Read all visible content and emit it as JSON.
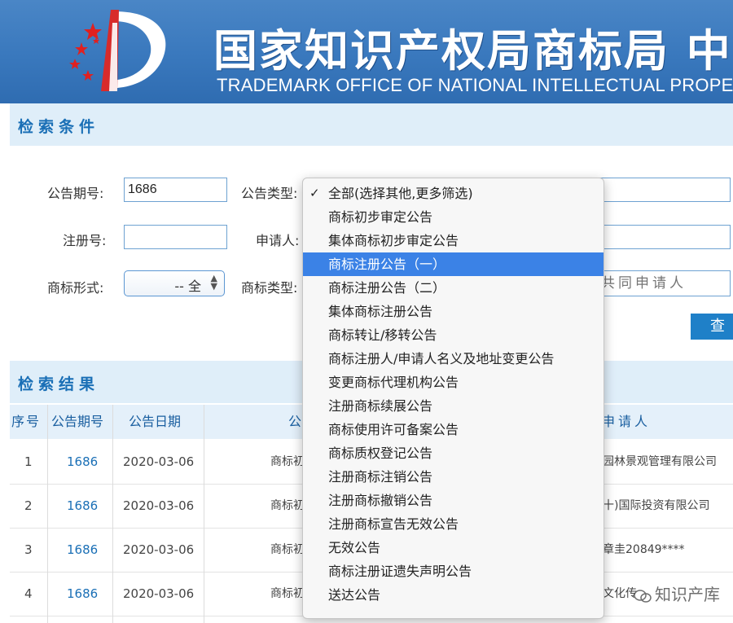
{
  "header": {
    "title_cn": "国家知识产权局商标局 中",
    "title_en": "TRADEMARK OFFICE OF NATIONAL INTELLECTUAL PROPERTY"
  },
  "search_section": {
    "title": "检索条件"
  },
  "form": {
    "issue_number_label": "公告期号:",
    "issue_number_value": "1686",
    "notice_type_label": "公告类型:",
    "reg_number_label": "注册号:",
    "reg_number_value": "",
    "applicant_label": "申请人:",
    "mark_form_label": "商标形式:",
    "mark_form_value": "-- 全",
    "mark_type_label": "商标类型:",
    "co_applicant_placeholder": "共同申请人",
    "search_button": "查"
  },
  "results_section": {
    "title": "检索结果"
  },
  "table": {
    "headers": [
      "序号",
      "公告期号",
      "公告日期",
      "公",
      "申请人"
    ],
    "rows": [
      {
        "index": "1",
        "issue": "1686",
        "date": "2020-03-06",
        "type": "商标初",
        "applicant": "园林景观管理有限公司"
      },
      {
        "index": "2",
        "issue": "1686",
        "date": "2020-03-06",
        "type": "商标初",
        "applicant": "十)国际投资有限公司"
      },
      {
        "index": "3",
        "issue": "1686",
        "date": "2020-03-06",
        "type": "商标初",
        "applicant": "章圭20849****"
      },
      {
        "index": "4",
        "issue": "1686",
        "date": "2020-03-06",
        "type": "商标初",
        "applicant": "文化传"
      }
    ]
  },
  "dropdown": {
    "selected_check": "✓",
    "items": [
      "全部(选择其他,更多筛选)",
      "商标初步审定公告",
      "集体商标初步审定公告",
      "商标注册公告（一）",
      "商标注册公告（二）",
      "集体商标注册公告",
      "商标转让/移转公告",
      "商标注册人/申请人名义及地址变更公告",
      "变更商标代理机构公告",
      "注册商标续展公告",
      "商标使用许可备案公告",
      "商标质权登记公告",
      "注册商标注销公告",
      "注册商标撤销公告",
      "注册商标宣告无效公告",
      "无效公告",
      "商标注册证遗失声明公告",
      "送达公告"
    ],
    "highlight_color": "#3b82e6"
  },
  "watermark": {
    "text": "知识产库"
  },
  "colors": {
    "header_blue": "#3978bd",
    "accent_blue": "#1a6fb6",
    "button_blue": "#1f80c8"
  }
}
